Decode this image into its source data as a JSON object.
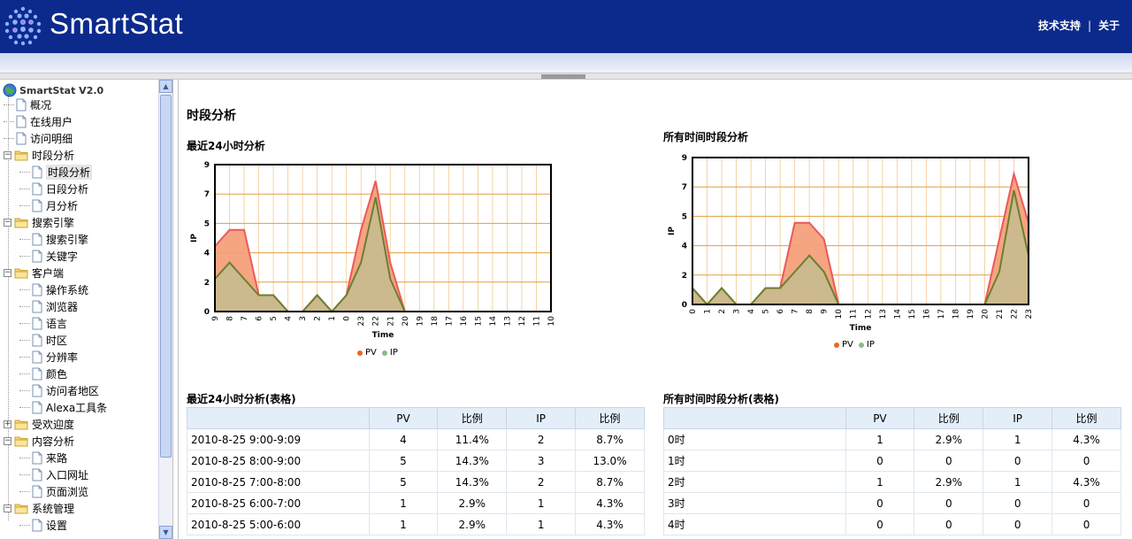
{
  "header": {
    "brand": "SmartStat",
    "links": [
      "技术支持",
      "关于"
    ]
  },
  "sidebar": {
    "root": "SmartStat V2.0",
    "items": [
      {
        "label": "概况",
        "level": 1,
        "kind": "page"
      },
      {
        "label": "在线用户",
        "level": 1,
        "kind": "page"
      },
      {
        "label": "访问明细",
        "level": 1,
        "kind": "page"
      },
      {
        "label": "时段分析",
        "level": 1,
        "kind": "folder"
      },
      {
        "label": "时段分析",
        "level": 2,
        "kind": "page",
        "selected": true
      },
      {
        "label": "日段分析",
        "level": 2,
        "kind": "page"
      },
      {
        "label": "月分析",
        "level": 2,
        "kind": "page"
      },
      {
        "label": "搜索引擎",
        "level": 1,
        "kind": "folder"
      },
      {
        "label": "搜索引擎",
        "level": 2,
        "kind": "page"
      },
      {
        "label": "关键字",
        "level": 2,
        "kind": "page"
      },
      {
        "label": "客户端",
        "level": 1,
        "kind": "folder"
      },
      {
        "label": "操作系统",
        "level": 2,
        "kind": "page"
      },
      {
        "label": "浏览器",
        "level": 2,
        "kind": "page"
      },
      {
        "label": "语言",
        "level": 2,
        "kind": "page"
      },
      {
        "label": "时区",
        "level": 2,
        "kind": "page"
      },
      {
        "label": "分辨率",
        "level": 2,
        "kind": "page"
      },
      {
        "label": "颜色",
        "level": 2,
        "kind": "page"
      },
      {
        "label": "访问者地区",
        "level": 2,
        "kind": "page"
      },
      {
        "label": "Alexa工具条",
        "level": 2,
        "kind": "page"
      },
      {
        "label": "受欢迎度",
        "level": 1,
        "kind": "folder",
        "collapsed": true
      },
      {
        "label": "内容分析",
        "level": 1,
        "kind": "folder"
      },
      {
        "label": "来路",
        "level": 2,
        "kind": "page"
      },
      {
        "label": "入口网址",
        "level": 2,
        "kind": "page"
      },
      {
        "label": "页面浏览",
        "level": 2,
        "kind": "page"
      },
      {
        "label": "系统管理",
        "level": 1,
        "kind": "folder"
      },
      {
        "label": "设置",
        "level": 2,
        "kind": "page"
      }
    ]
  },
  "main": {
    "title": "时段分析",
    "chart1_title": "最近24小时分析",
    "chart2_title": "所有时间时段分析",
    "table1_title": "最近24小时分析(表格)",
    "table2_title": "所有时间时段分析(表格)",
    "table1": {
      "headers": [
        "",
        "PV",
        "比例",
        "IP",
        "比例"
      ],
      "rows": [
        [
          "2010-8-25 9:00-9:09",
          "4",
          "11.4%",
          "2",
          "8.7%"
        ],
        [
          "2010-8-25 8:00-9:00",
          "5",
          "14.3%",
          "3",
          "13.0%"
        ],
        [
          "2010-8-25 7:00-8:00",
          "5",
          "14.3%",
          "2",
          "8.7%"
        ],
        [
          "2010-8-25 6:00-7:00",
          "1",
          "2.9%",
          "1",
          "4.3%"
        ],
        [
          "2010-8-25 5:00-6:00",
          "1",
          "2.9%",
          "1",
          "4.3%"
        ]
      ]
    },
    "table2": {
      "headers": [
        "",
        "PV",
        "比例",
        "IP",
        "比例"
      ],
      "rows": [
        [
          "0时",
          "1",
          "2.9%",
          "1",
          "4.3%"
        ],
        [
          "1时",
          "0",
          "0",
          "0",
          "0"
        ],
        [
          "2时",
          "1",
          "2.9%",
          "1",
          "4.3%"
        ],
        [
          "3时",
          "0",
          "0",
          "0",
          "0"
        ],
        [
          "4时",
          "0",
          "0",
          "0",
          "0"
        ]
      ]
    }
  },
  "colors": {
    "pv_fill": "#f4a07a",
    "pv_line": "#ea5a5a",
    "ip_fill": "#c9b98e",
    "ip_line": "#6b7f2f",
    "pv_dot": "#ee6622",
    "ip_dot": "#88bb88",
    "grid": "#e0a040"
  },
  "chart_data": [
    {
      "type": "area",
      "categories": [
        "9",
        "8",
        "7",
        "6",
        "5",
        "4",
        "3",
        "2",
        "1",
        "0",
        "23",
        "22",
        "21",
        "20",
        "19",
        "18",
        "17",
        "16",
        "15",
        "14",
        "13",
        "12",
        "11",
        "10"
      ],
      "series": [
        {
          "name": "PV",
          "values": [
            4,
            5,
            5,
            1,
            1,
            0,
            0,
            1,
            0,
            1,
            5,
            8,
            3,
            0,
            0,
            0,
            0,
            0,
            0,
            0,
            0,
            0,
            0,
            0
          ]
        },
        {
          "name": "IP",
          "values": [
            2,
            3,
            2,
            1,
            1,
            0,
            0,
            1,
            0,
            1,
            3,
            7,
            2,
            0,
            0,
            0,
            0,
            0,
            0,
            0,
            0,
            0,
            0,
            0
          ]
        }
      ],
      "xlabel": "Time",
      "ylabel": "IP",
      "yticks": [
        "0",
        "2",
        "4",
        "5",
        "7",
        "9"
      ],
      "ylim": [
        0,
        9
      ],
      "legend": [
        "PV",
        "IP"
      ]
    },
    {
      "type": "area",
      "categories": [
        "0",
        "1",
        "2",
        "3",
        "4",
        "5",
        "6",
        "7",
        "8",
        "9",
        "10",
        "11",
        "12",
        "13",
        "14",
        "15",
        "16",
        "17",
        "18",
        "19",
        "20",
        "21",
        "22",
        "23"
      ],
      "series": [
        {
          "name": "PV",
          "values": [
            1,
            0,
            1,
            0,
            0,
            1,
            1,
            5,
            5,
            4,
            0,
            0,
            0,
            0,
            0,
            0,
            0,
            0,
            0,
            0,
            0,
            4,
            8,
            5
          ]
        },
        {
          "name": "IP",
          "values": [
            1,
            0,
            1,
            0,
            0,
            1,
            1,
            2,
            3,
            2,
            0,
            0,
            0,
            0,
            0,
            0,
            0,
            0,
            0,
            0,
            0,
            2,
            7,
            3
          ]
        }
      ],
      "xlabel": "Time",
      "ylabel": "IP",
      "yticks": [
        "0",
        "2",
        "4",
        "5",
        "7",
        "9"
      ],
      "ylim": [
        0,
        9
      ],
      "legend": [
        "PV",
        "IP"
      ]
    }
  ]
}
